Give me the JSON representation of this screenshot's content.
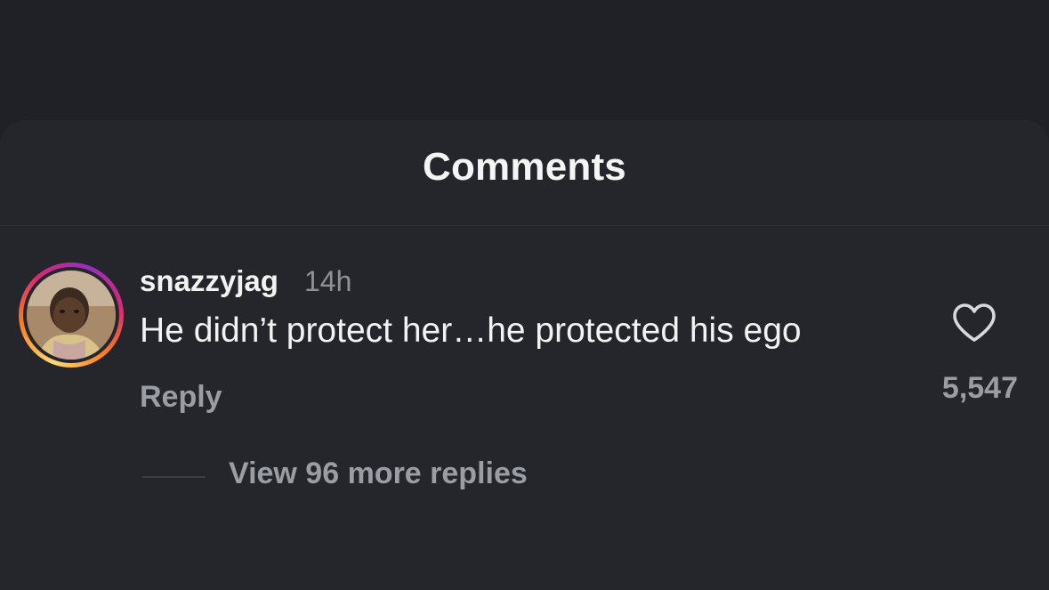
{
  "sheet": {
    "title": "Comments"
  },
  "comment": {
    "username": "snazzyjag",
    "timestamp": "14h",
    "text": "He didn’t protect her…he protected his ego",
    "reply_label": "Reply",
    "like_count": "5,547",
    "like_icon": "heart-outline-icon",
    "view_replies_label": "View 96 more replies"
  },
  "colors": {
    "background": "#1f2126",
    "sheet": "#24262b",
    "primary_text": "#f2f2f2",
    "secondary_text": "#9a9da3",
    "story_ring": [
      "#feda75",
      "#fa7e1e",
      "#d62976",
      "#962fbf"
    ]
  }
}
